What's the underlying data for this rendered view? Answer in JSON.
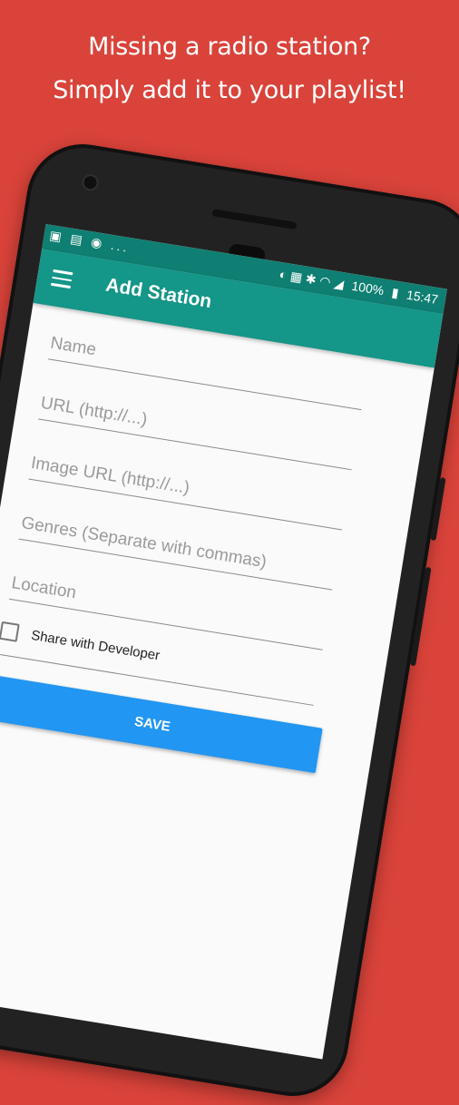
{
  "promo": {
    "line1": "Missing a radio station?",
    "line2": "Simply add it to your playlist!"
  },
  "statusbar": {
    "notifications": "▣ ▤ ◉ ...",
    "icons": "◐ ▦ ✱ ◠ ◢",
    "battery": "100%",
    "time": "15:47"
  },
  "appbar": {
    "title": "Add Station"
  },
  "form": {
    "name_placeholder": "Name",
    "url_placeholder": "URL (http://...)",
    "image_url_placeholder": "Image URL (http://...)",
    "genres_placeholder": "Genres (Separate with commas)",
    "location_placeholder": "Location",
    "share_label": "Share with Developer",
    "save_label": "SAVE"
  },
  "colors": {
    "background": "#d9433a",
    "appbar": "#149688",
    "statusbar": "#0e7f72",
    "save_button": "#2196f3"
  },
  "icons": [
    "menu-icon",
    "alarm-icon",
    "cast-icon",
    "bluetooth-icon",
    "wifi-icon",
    "signal-icon",
    "battery-icon",
    "checkbox-icon"
  ]
}
